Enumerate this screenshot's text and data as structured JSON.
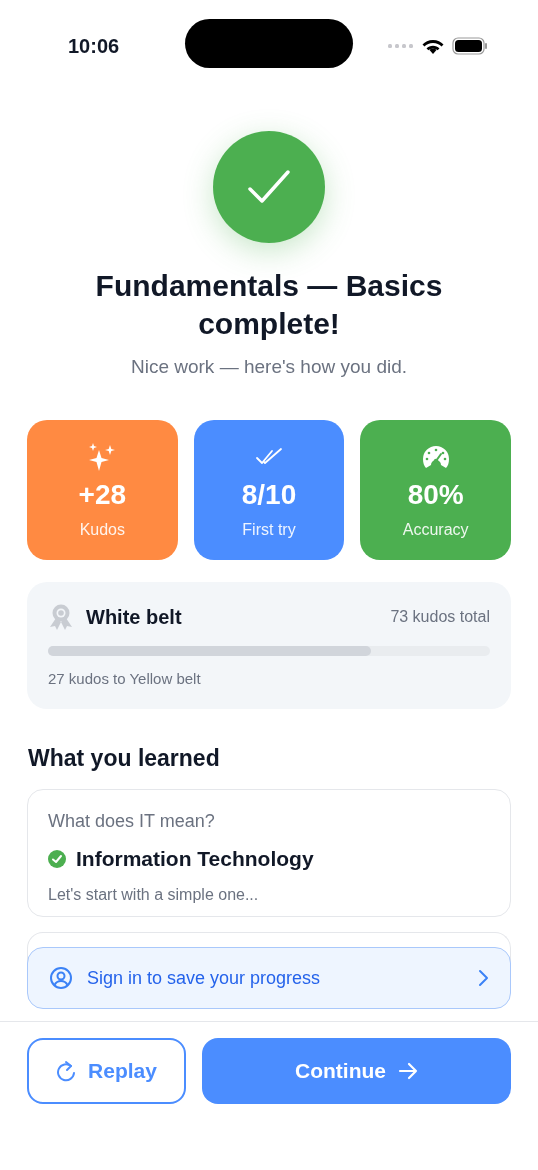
{
  "status_bar": {
    "time": "10:06"
  },
  "hero": {
    "title": "Fundamentals — Basics complete!",
    "subtitle": "Nice work — here's how you did."
  },
  "stats": [
    {
      "kind": "sparkle",
      "value": "+28",
      "label": "Kudos",
      "color": "#ff8a42"
    },
    {
      "kind": "double-check",
      "value": "8/10",
      "label": "First try",
      "color": "#4b8dff"
    },
    {
      "kind": "gauge",
      "value": "80%",
      "label": "Accuracy",
      "color": "#4caf50"
    }
  ],
  "belt": {
    "name": "White belt",
    "total": "73 kudos total",
    "level": 0.73,
    "next": "27 kudos to Yellow belt"
  },
  "learned": {
    "heading": "What you learned",
    "items": [
      {
        "question": "What does IT mean?",
        "answer": "Information Technology",
        "correct": true,
        "note": "Let's start with a simple one..."
      }
    ]
  },
  "sign_in": {
    "label": "Sign in to save your progress"
  },
  "buttons": [
    {
      "kind": "secondary",
      "label": "Replay"
    },
    {
      "kind": "primary",
      "label": "Continue"
    }
  ]
}
